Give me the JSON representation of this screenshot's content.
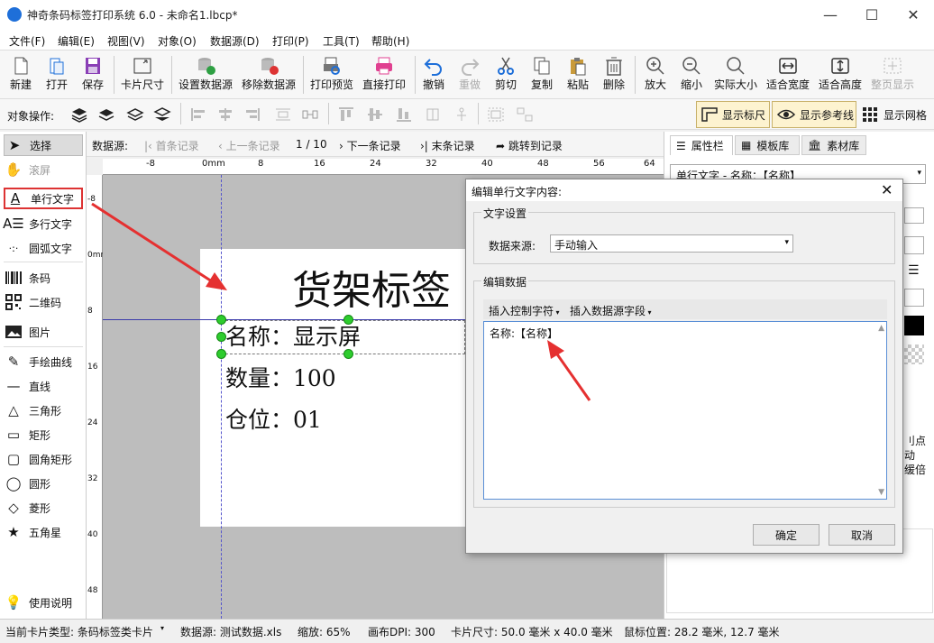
{
  "window": {
    "title": "神奇条码标签打印系统 6.0 - 未命名1.lbcp*",
    "minimize": "—",
    "maximize": "☐",
    "close": "✕"
  },
  "menu": [
    "文件(F)",
    "编辑(E)",
    "视图(V)",
    "对象(O)",
    "数据源(D)",
    "打印(P)",
    "工具(T)",
    "帮助(H)"
  ],
  "toolbar": {
    "new": "新建",
    "open": "打开",
    "save": "保存",
    "card_size": "卡片尺寸",
    "set_datasource": "设置数据源",
    "remove_datasource": "移除数据源",
    "print_preview": "打印预览",
    "direct_print": "直接打印",
    "undo": "撤销",
    "redo": "重做",
    "cut": "剪切",
    "copy": "复制",
    "paste": "粘贴",
    "delete": "删除",
    "zoom_in": "放大",
    "zoom_out": "缩小",
    "actual_size": "实际大小",
    "fit_width": "适合宽度",
    "fit_height": "适合高度",
    "fit_page": "整页显示"
  },
  "objbar": {
    "label": "对象操作:",
    "show_ruler": "显示标尺",
    "show_guides": "显示参考线",
    "show_grid": "显示网格"
  },
  "tools": {
    "select": "选择",
    "scroll": "滚屏",
    "single_text": "单行文字",
    "multi_text": "多行文字",
    "arc_text": "圆弧文字",
    "barcode": "条码",
    "qrcode": "二维码",
    "image": "图片",
    "freehand": "手绘曲线",
    "line": "直线",
    "triangle": "三角形",
    "rect": "矩形",
    "rounded_rect": "圆角矩形",
    "ellipse": "圆形",
    "diamond": "菱形",
    "star": "五角星",
    "help": "使用说明"
  },
  "navbar": {
    "label": "数据源:",
    "first": "首条记录",
    "prev": "上一条记录",
    "count": "1 / 10",
    "next": "下一条记录",
    "last": "末条记录",
    "jump": "跳转到记录"
  },
  "ruler_h": [
    "-8",
    "0mm",
    "8",
    "16",
    "24",
    "32",
    "40",
    "48",
    "56",
    "64"
  ],
  "ruler_v": [
    "-8",
    "0mm",
    "8",
    "16",
    "24",
    "32",
    "40",
    "48"
  ],
  "label": {
    "title": "货架标签",
    "line1": "名称：显示屏",
    "line2": "数量：100",
    "line3": "仓位：01"
  },
  "right_panel": {
    "tab_props": "属性栏",
    "tab_templates": "模板库",
    "tab_assets": "素材库",
    "object_name": "单行文字 - 名称：【名称】",
    "partial1": "刂点",
    "partial2": "动",
    "partial3": "缓倍"
  },
  "dialog": {
    "title": "编辑单行文字内容:",
    "group_text": "文字设置",
    "source_label": "数据来源:",
    "source_value": "手动输入",
    "group_edit": "编辑数据",
    "insert_ctrl": "插入控制字符",
    "insert_field": "插入数据源字段",
    "content": "名称:【名称】",
    "ok": "确定",
    "cancel": "取消"
  },
  "status": {
    "card_type": "当前卡片类型: 条码标签类卡片",
    "datasource": "数据源: 测试数据.xls",
    "zoom": "缩放: 65%",
    "dpi": "画布DPI: 300",
    "card_size": "卡片尺寸: 50.0 毫米 x 40.0 毫米",
    "mouse": "鼠标位置: 28.2 毫米, 12.7 毫米"
  },
  "colors": {
    "accent": "#1e6fd9",
    "arrow": "#e53030",
    "handle": "#2ecc2e",
    "highlight": "#d33"
  }
}
